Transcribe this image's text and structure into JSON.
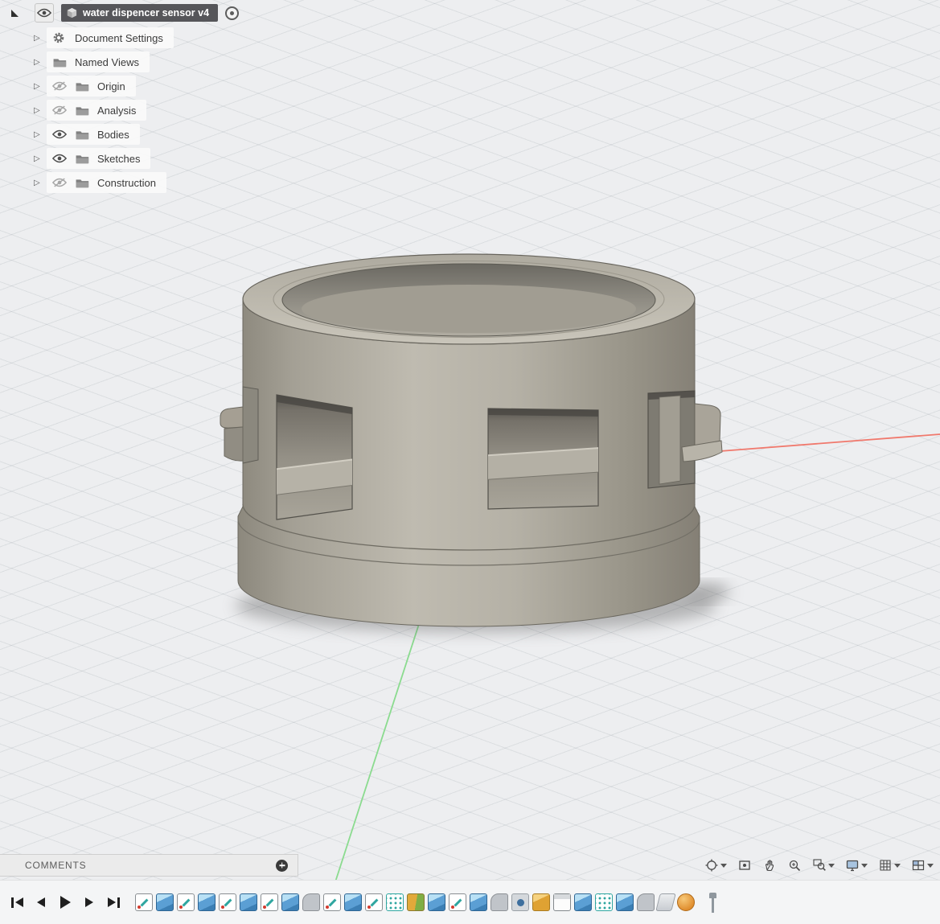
{
  "browser": {
    "root": {
      "title": "water dispencer sensor v4"
    },
    "items": [
      {
        "label": "Document Settings",
        "icon": "gear-icon",
        "visibility": "none"
      },
      {
        "label": "Named Views",
        "icon": "folder-icon",
        "visibility": "none"
      },
      {
        "label": "Origin",
        "icon": "folder-icon",
        "visibility": "hidden"
      },
      {
        "label": "Analysis",
        "icon": "folder-icon",
        "visibility": "hidden"
      },
      {
        "label": "Bodies",
        "icon": "folder-icon",
        "visibility": "visible"
      },
      {
        "label": "Sketches",
        "icon": "folder-icon",
        "visibility": "visible"
      },
      {
        "label": "Construction",
        "icon": "folder-icon",
        "visibility": "hidden"
      }
    ]
  },
  "viewport": {
    "model_description": "gray cylindrical sensor collar with side windows and snap clips",
    "model_color": "#aca89d",
    "axis_x_color": "#f0796d",
    "axis_y_color": "#8bdb8f",
    "background_color": "#edeef0"
  },
  "comments_bar": {
    "label": "COMMENTS"
  },
  "nav_toolbar": {
    "icons": [
      "orbit",
      "fit-view",
      "pan",
      "zoom",
      "zoom-window",
      "display-settings",
      "grid-and-snaps",
      "viewports"
    ]
  },
  "timeline": {
    "playback": [
      "go-to-start",
      "step-back",
      "play",
      "step-forward",
      "go-to-end"
    ],
    "features": [
      "sketch",
      "extrude",
      "sketch",
      "extrude",
      "sketch",
      "extrude",
      "sketch",
      "extrude",
      "fillet",
      "sketch",
      "extrude",
      "sketch",
      "pattern",
      "combine",
      "extrude",
      "sketch",
      "extrude",
      "fillet",
      "hole",
      "move",
      "box",
      "extrude",
      "pattern",
      "extrude",
      "fillet",
      "plane",
      "form"
    ]
  }
}
